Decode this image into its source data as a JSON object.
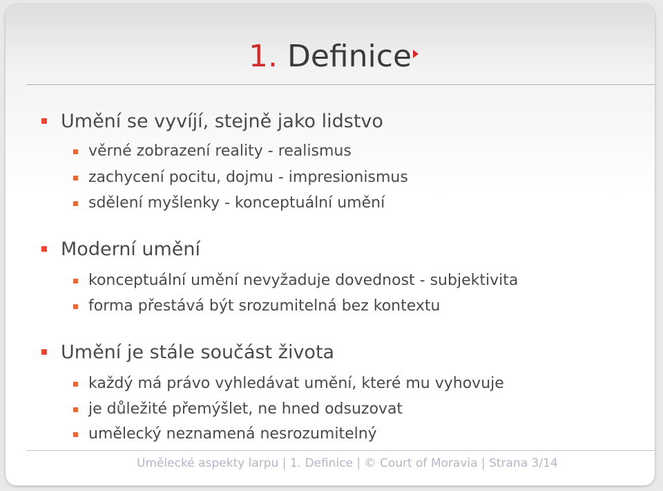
{
  "title": {
    "number": "1.",
    "text": "Definice"
  },
  "sections": [
    {
      "heading": "Umění se vyvíjí, stejně jako lidstvo",
      "items": [
        "věrné zobrazení reality - realismus",
        "zachycení pocitu, dojmu - impresionismus",
        "sdělení myšlenky - konceptuální umění"
      ]
    },
    {
      "heading": "Moderní umění",
      "items": [
        "konceptuální umění nevyžaduje dovednost - subjektivita",
        "forma přestává být srozumitelná bez kontextu"
      ]
    },
    {
      "heading": "Umění je stále součást života",
      "items": [
        "každý má právo vyhledávat umění, které mu vyhovuje",
        "je důležité přemýšlet, ne hned odsuzovat",
        "umělecký neznamená nesrozumitelný"
      ]
    }
  ],
  "footer": "Umělecké aspekty larpu | 1. Definice | © Court of Moravia | Strana 3/14",
  "colors": {
    "accent": "#d12b2b",
    "bullet": "#e8462e",
    "text": "#4a4a4a",
    "footer": "#b5b5c8"
  }
}
